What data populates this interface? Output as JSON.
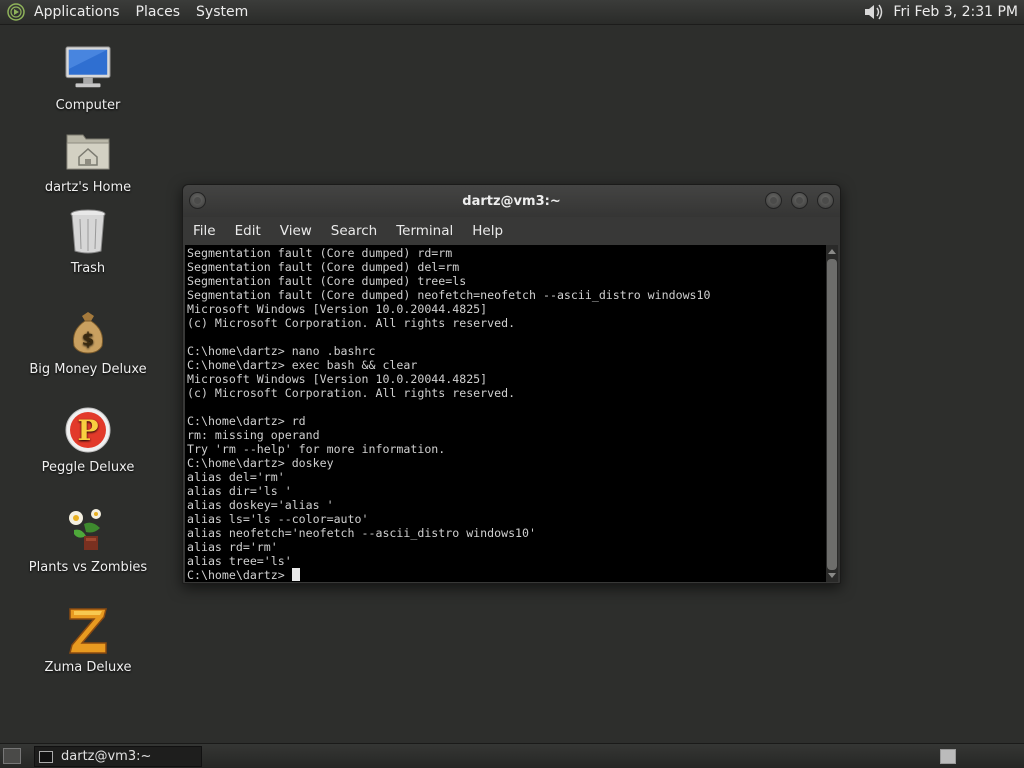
{
  "top_panel": {
    "menus": [
      "Applications",
      "Places",
      "System"
    ],
    "clock": "Fri Feb  3,  2:31 PM"
  },
  "desktop_icons": [
    {
      "label": "Computer",
      "icon": "computer-icon"
    },
    {
      "label": "dartz's Home",
      "icon": "home-folder-icon"
    },
    {
      "label": "Trash",
      "icon": "trash-icon"
    },
    {
      "label": "Big Money Deluxe",
      "icon": "money-bag-icon"
    },
    {
      "label": "Peggle Deluxe",
      "icon": "peggle-icon"
    },
    {
      "label": "Plants vs Zombies",
      "icon": "plants-vs-zombies-icon"
    },
    {
      "label": "Zuma Deluxe",
      "icon": "zuma-icon"
    }
  ],
  "terminal": {
    "title": "dartz@vm3:~",
    "menu": [
      "File",
      "Edit",
      "View",
      "Search",
      "Terminal",
      "Help"
    ],
    "lines": [
      "Segmentation fault (Core dumped) rd=rm",
      "Segmentation fault (Core dumped) del=rm",
      "Segmentation fault (Core dumped) tree=ls",
      "Segmentation fault (Core dumped) neofetch=neofetch --ascii_distro windows10",
      "Microsoft Windows [Version 10.0.20044.4825]",
      "(c) Microsoft Corporation. All rights reserved.",
      "",
      "C:\\home\\dartz> nano .bashrc",
      "C:\\home\\dartz> exec bash && clear",
      "Microsoft Windows [Version 10.0.20044.4825]",
      "(c) Microsoft Corporation. All rights reserved.",
      "",
      "C:\\home\\dartz> rd",
      "rm: missing operand",
      "Try 'rm --help' for more information.",
      "C:\\home\\dartz> doskey",
      "alias del='rm'",
      "alias dir='ls '",
      "alias doskey='alias '",
      "alias ls='ls --color=auto'",
      "alias neofetch='neofetch --ascii_distro windows10'",
      "alias rd='rm'",
      "alias tree='ls'"
    ],
    "prompt": "C:\\home\\dartz> "
  },
  "taskbar": {
    "task_label": "dartz@vm3:~"
  },
  "colors": {
    "desktop": "#2d2e2c",
    "terminal_bg": "#000000",
    "terminal_fg": "#d0d0d0"
  }
}
